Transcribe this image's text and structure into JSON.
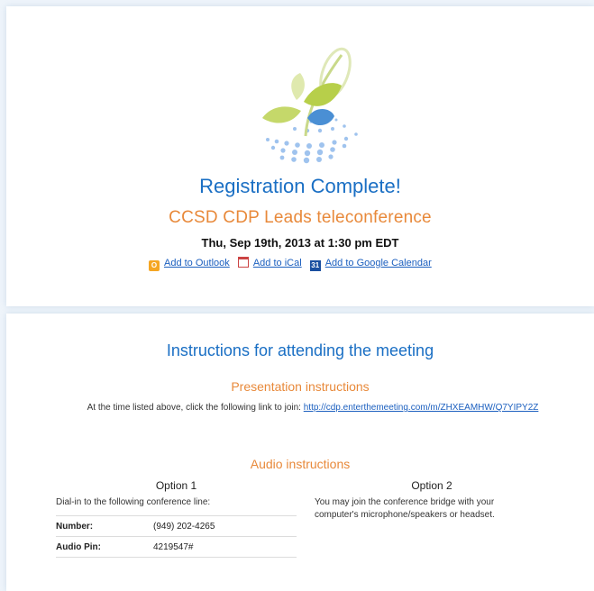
{
  "header": {
    "title": "Registration Complete!",
    "event_name": "CCSD CDP Leads teleconference",
    "datetime": "Thu, Sep 19th, 2013 at 1:30 pm EDT"
  },
  "calendar_links": {
    "outlook": "Add to Outlook",
    "ical": "Add to iCal",
    "google": "Add to Google Calendar",
    "gcal_icon_text": "31"
  },
  "instructions": {
    "heading": "Instructions for attending the meeting",
    "presentation": {
      "heading": "Presentation instructions",
      "text_before": "At the time listed above, click the following link to join: ",
      "link": "http://cdp.enterthemeeting.com/m/ZHXEAMHW/Q7YIPY2Z"
    },
    "audio": {
      "heading": "Audio instructions",
      "option1": {
        "title": "Option 1",
        "text": "Dial-in to the following conference line:",
        "number_label": "Number:",
        "number_value": "(949) 202-4265",
        "pin_label": "Audio Pin:",
        "pin_value": "4219547#"
      },
      "option2": {
        "title": "Option 2",
        "text": "You may join the conference bridge with your computer's microphone/speakers or headset."
      }
    }
  },
  "colors": {
    "title_blue": "#1a6fc4",
    "accent_orange": "#e8893a",
    "link_blue": "#1b5fbf"
  }
}
